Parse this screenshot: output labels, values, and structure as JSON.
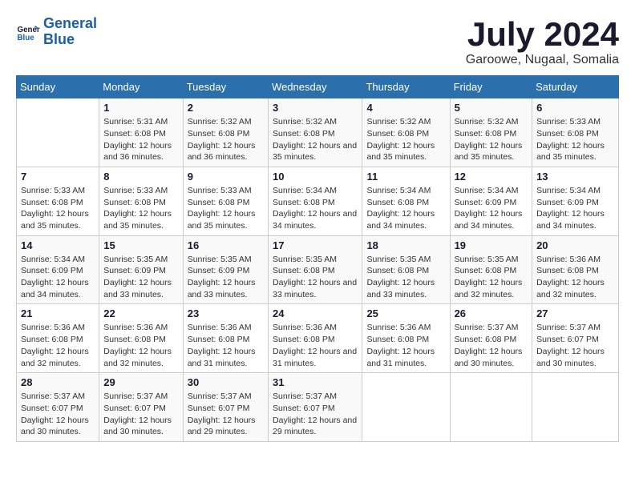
{
  "logo": {
    "line1": "General",
    "line2": "Blue"
  },
  "title": "July 2024",
  "subtitle": "Garoowe, Nugaal, Somalia",
  "header": {
    "days": [
      "Sunday",
      "Monday",
      "Tuesday",
      "Wednesday",
      "Thursday",
      "Friday",
      "Saturday"
    ]
  },
  "weeks": [
    {
      "cells": [
        {
          "day": "",
          "empty": true
        },
        {
          "day": "1",
          "sunrise": "Sunrise: 5:31 AM",
          "sunset": "Sunset: 6:08 PM",
          "daylight": "Daylight: 12 hours and 36 minutes."
        },
        {
          "day": "2",
          "sunrise": "Sunrise: 5:32 AM",
          "sunset": "Sunset: 6:08 PM",
          "daylight": "Daylight: 12 hours and 36 minutes."
        },
        {
          "day": "3",
          "sunrise": "Sunrise: 5:32 AM",
          "sunset": "Sunset: 6:08 PM",
          "daylight": "Daylight: 12 hours and 35 minutes."
        },
        {
          "day": "4",
          "sunrise": "Sunrise: 5:32 AM",
          "sunset": "Sunset: 6:08 PM",
          "daylight": "Daylight: 12 hours and 35 minutes."
        },
        {
          "day": "5",
          "sunrise": "Sunrise: 5:32 AM",
          "sunset": "Sunset: 6:08 PM",
          "daylight": "Daylight: 12 hours and 35 minutes."
        },
        {
          "day": "6",
          "sunrise": "Sunrise: 5:33 AM",
          "sunset": "Sunset: 6:08 PM",
          "daylight": "Daylight: 12 hours and 35 minutes."
        }
      ]
    },
    {
      "cells": [
        {
          "day": "7",
          "sunrise": "Sunrise: 5:33 AM",
          "sunset": "Sunset: 6:08 PM",
          "daylight": "Daylight: 12 hours and 35 minutes."
        },
        {
          "day": "8",
          "sunrise": "Sunrise: 5:33 AM",
          "sunset": "Sunset: 6:08 PM",
          "daylight": "Daylight: 12 hours and 35 minutes."
        },
        {
          "day": "9",
          "sunrise": "Sunrise: 5:33 AM",
          "sunset": "Sunset: 6:08 PM",
          "daylight": "Daylight: 12 hours and 35 minutes."
        },
        {
          "day": "10",
          "sunrise": "Sunrise: 5:34 AM",
          "sunset": "Sunset: 6:08 PM",
          "daylight": "Daylight: 12 hours and 34 minutes."
        },
        {
          "day": "11",
          "sunrise": "Sunrise: 5:34 AM",
          "sunset": "Sunset: 6:08 PM",
          "daylight": "Daylight: 12 hours and 34 minutes."
        },
        {
          "day": "12",
          "sunrise": "Sunrise: 5:34 AM",
          "sunset": "Sunset: 6:09 PM",
          "daylight": "Daylight: 12 hours and 34 minutes."
        },
        {
          "day": "13",
          "sunrise": "Sunrise: 5:34 AM",
          "sunset": "Sunset: 6:09 PM",
          "daylight": "Daylight: 12 hours and 34 minutes."
        }
      ]
    },
    {
      "cells": [
        {
          "day": "14",
          "sunrise": "Sunrise: 5:34 AM",
          "sunset": "Sunset: 6:09 PM",
          "daylight": "Daylight: 12 hours and 34 minutes."
        },
        {
          "day": "15",
          "sunrise": "Sunrise: 5:35 AM",
          "sunset": "Sunset: 6:09 PM",
          "daylight": "Daylight: 12 hours and 33 minutes."
        },
        {
          "day": "16",
          "sunrise": "Sunrise: 5:35 AM",
          "sunset": "Sunset: 6:09 PM",
          "daylight": "Daylight: 12 hours and 33 minutes."
        },
        {
          "day": "17",
          "sunrise": "Sunrise: 5:35 AM",
          "sunset": "Sunset: 6:08 PM",
          "daylight": "Daylight: 12 hours and 33 minutes."
        },
        {
          "day": "18",
          "sunrise": "Sunrise: 5:35 AM",
          "sunset": "Sunset: 6:08 PM",
          "daylight": "Daylight: 12 hours and 33 minutes."
        },
        {
          "day": "19",
          "sunrise": "Sunrise: 5:35 AM",
          "sunset": "Sunset: 6:08 PM",
          "daylight": "Daylight: 12 hours and 32 minutes."
        },
        {
          "day": "20",
          "sunrise": "Sunrise: 5:36 AM",
          "sunset": "Sunset: 6:08 PM",
          "daylight": "Daylight: 12 hours and 32 minutes."
        }
      ]
    },
    {
      "cells": [
        {
          "day": "21",
          "sunrise": "Sunrise: 5:36 AM",
          "sunset": "Sunset: 6:08 PM",
          "daylight": "Daylight: 12 hours and 32 minutes."
        },
        {
          "day": "22",
          "sunrise": "Sunrise: 5:36 AM",
          "sunset": "Sunset: 6:08 PM",
          "daylight": "Daylight: 12 hours and 32 minutes."
        },
        {
          "day": "23",
          "sunrise": "Sunrise: 5:36 AM",
          "sunset": "Sunset: 6:08 PM",
          "daylight": "Daylight: 12 hours and 31 minutes."
        },
        {
          "day": "24",
          "sunrise": "Sunrise: 5:36 AM",
          "sunset": "Sunset: 6:08 PM",
          "daylight": "Daylight: 12 hours and 31 minutes."
        },
        {
          "day": "25",
          "sunrise": "Sunrise: 5:36 AM",
          "sunset": "Sunset: 6:08 PM",
          "daylight": "Daylight: 12 hours and 31 minutes."
        },
        {
          "day": "26",
          "sunrise": "Sunrise: 5:37 AM",
          "sunset": "Sunset: 6:08 PM",
          "daylight": "Daylight: 12 hours and 30 minutes."
        },
        {
          "day": "27",
          "sunrise": "Sunrise: 5:37 AM",
          "sunset": "Sunset: 6:07 PM",
          "daylight": "Daylight: 12 hours and 30 minutes."
        }
      ]
    },
    {
      "cells": [
        {
          "day": "28",
          "sunrise": "Sunrise: 5:37 AM",
          "sunset": "Sunset: 6:07 PM",
          "daylight": "Daylight: 12 hours and 30 minutes."
        },
        {
          "day": "29",
          "sunrise": "Sunrise: 5:37 AM",
          "sunset": "Sunset: 6:07 PM",
          "daylight": "Daylight: 12 hours and 30 minutes."
        },
        {
          "day": "30",
          "sunrise": "Sunrise: 5:37 AM",
          "sunset": "Sunset: 6:07 PM",
          "daylight": "Daylight: 12 hours and 29 minutes."
        },
        {
          "day": "31",
          "sunrise": "Sunrise: 5:37 AM",
          "sunset": "Sunset: 6:07 PM",
          "daylight": "Daylight: 12 hours and 29 minutes."
        },
        {
          "day": "",
          "empty": true
        },
        {
          "day": "",
          "empty": true
        },
        {
          "day": "",
          "empty": true
        }
      ]
    }
  ]
}
